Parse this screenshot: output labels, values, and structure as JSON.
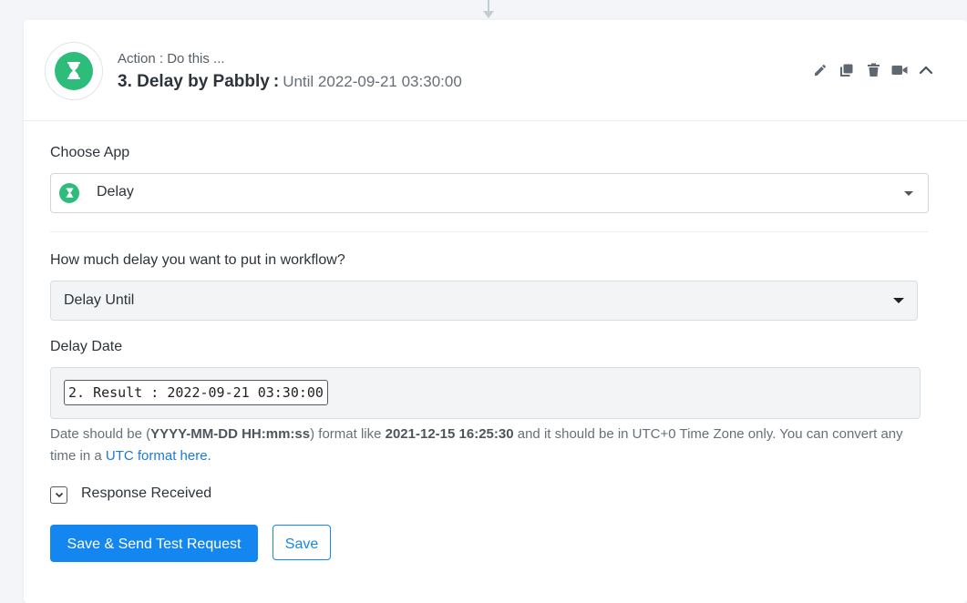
{
  "header": {
    "subtitle": "Action : Do this ...",
    "step_title": "3. Delay by Pabbly",
    "separator": ":",
    "until_text": "Until 2022-09-21 03:30:00",
    "icons": [
      "pencil-icon",
      "duplicate-icon",
      "trash-icon",
      "video-icon",
      "chevron-up-icon"
    ]
  },
  "choose_app": {
    "label": "Choose App",
    "selected": "Delay"
  },
  "delay_type": {
    "label": "How much delay you want to put in workflow?",
    "selected": "Delay Until"
  },
  "delay_date": {
    "label": "Delay Date",
    "token": "2. Result : 2022-09-21 03:30:00"
  },
  "help": {
    "part1": "Date should be (",
    "format": "YYYY-MM-DD HH:mm:ss",
    "part2": ") format like ",
    "example": "2021-12-15 16:25:30",
    "part3": " and it should be in UTC+0 Time Zone only. You can convert any time in a ",
    "link": "UTC format here."
  },
  "response": {
    "label": "Response Received"
  },
  "buttons": {
    "save_send": "Save & Send Test Request",
    "save": "Save"
  },
  "colors": {
    "brand_green": "#2ebc7a",
    "primary_blue": "#1486f0"
  }
}
